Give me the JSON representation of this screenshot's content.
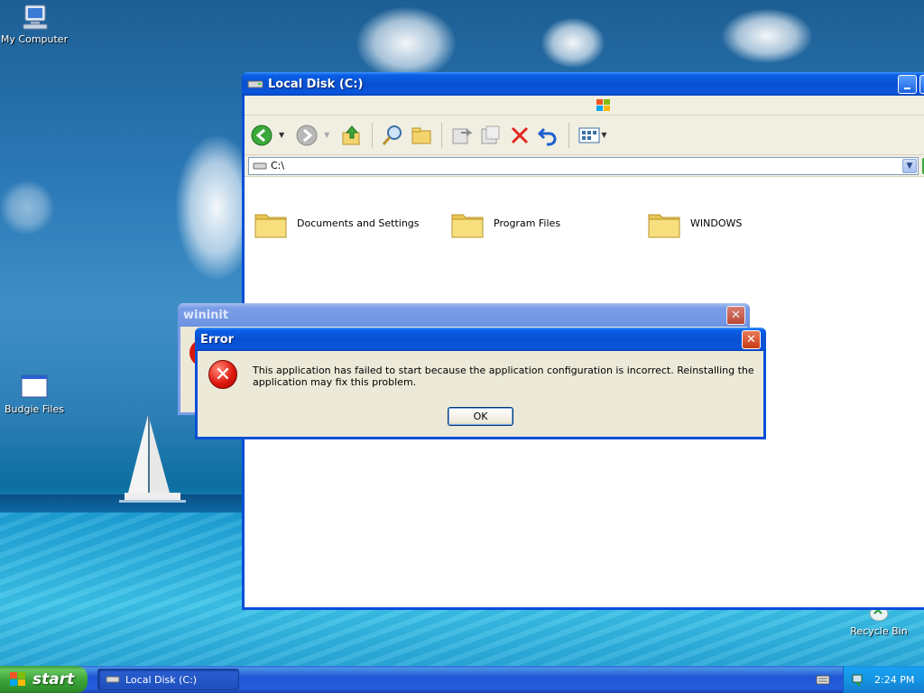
{
  "desktop": {
    "icons": [
      {
        "label": "My Computer"
      },
      {
        "label": "Budgie Files"
      },
      {
        "label": "Recycle Bin"
      }
    ]
  },
  "explorer": {
    "title": "Local Disk (C:)",
    "address": "C:\\",
    "folders": [
      {
        "label": "Documents and Settings"
      },
      {
        "label": "Program Files"
      },
      {
        "label": "WINDOWS"
      }
    ]
  },
  "wininit": {
    "title": "wininit"
  },
  "error_dialog": {
    "title": "Error",
    "message": "This application has failed to start because the application configuration is incorrect. Reinstalling the application may fix this problem.",
    "ok_label": "OK"
  },
  "taskbar": {
    "start_label": "start",
    "tasks": [
      {
        "label": "Local Disk (C:)"
      }
    ],
    "clock": "2:24 PM"
  },
  "colors": {
    "titlebar_active": "#0a55dc",
    "start_green": "#3ea53a",
    "error_red": "#e01a10"
  }
}
